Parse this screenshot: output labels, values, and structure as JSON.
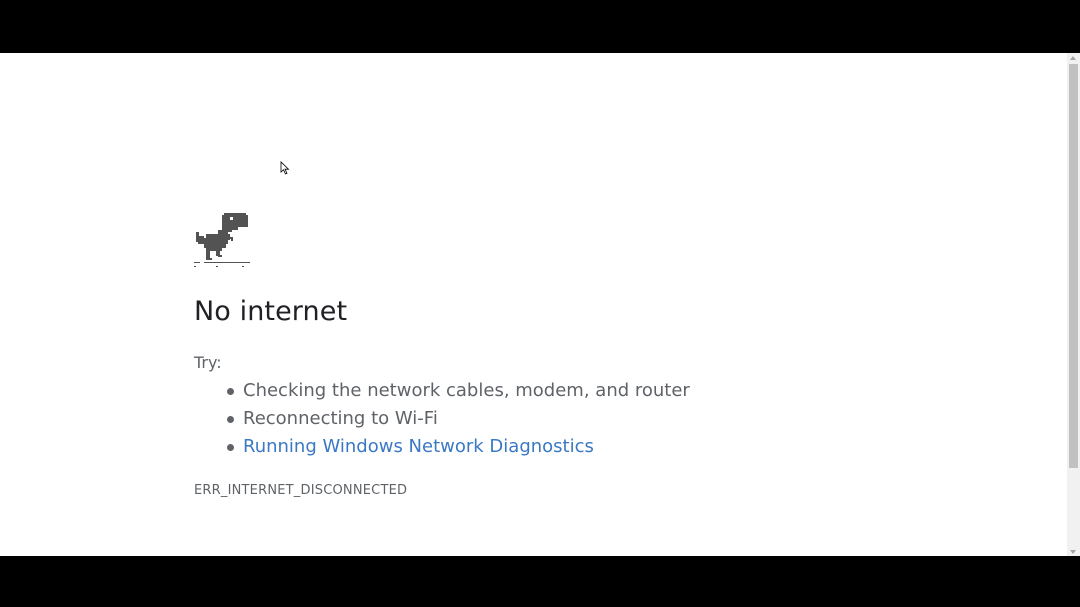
{
  "page": {
    "title": "No internet",
    "try_label": "Try:",
    "suggestions": [
      {
        "text": "Checking the network cables, modem, and router",
        "is_link": false
      },
      {
        "text": "Reconnecting to Wi-Fi",
        "is_link": false
      },
      {
        "text": "Running Windows Network Diagnostics",
        "is_link": true
      }
    ],
    "error_code": "ERR_INTERNET_DISCONNECTED"
  },
  "icons": {
    "dino": "offline-dino-icon",
    "cursor": "mouse-pointer-icon"
  },
  "colors": {
    "background": "#ffffff",
    "title": "#202124",
    "body_text": "#5f6368",
    "link": "#3b78c4",
    "dino": "#535353"
  }
}
